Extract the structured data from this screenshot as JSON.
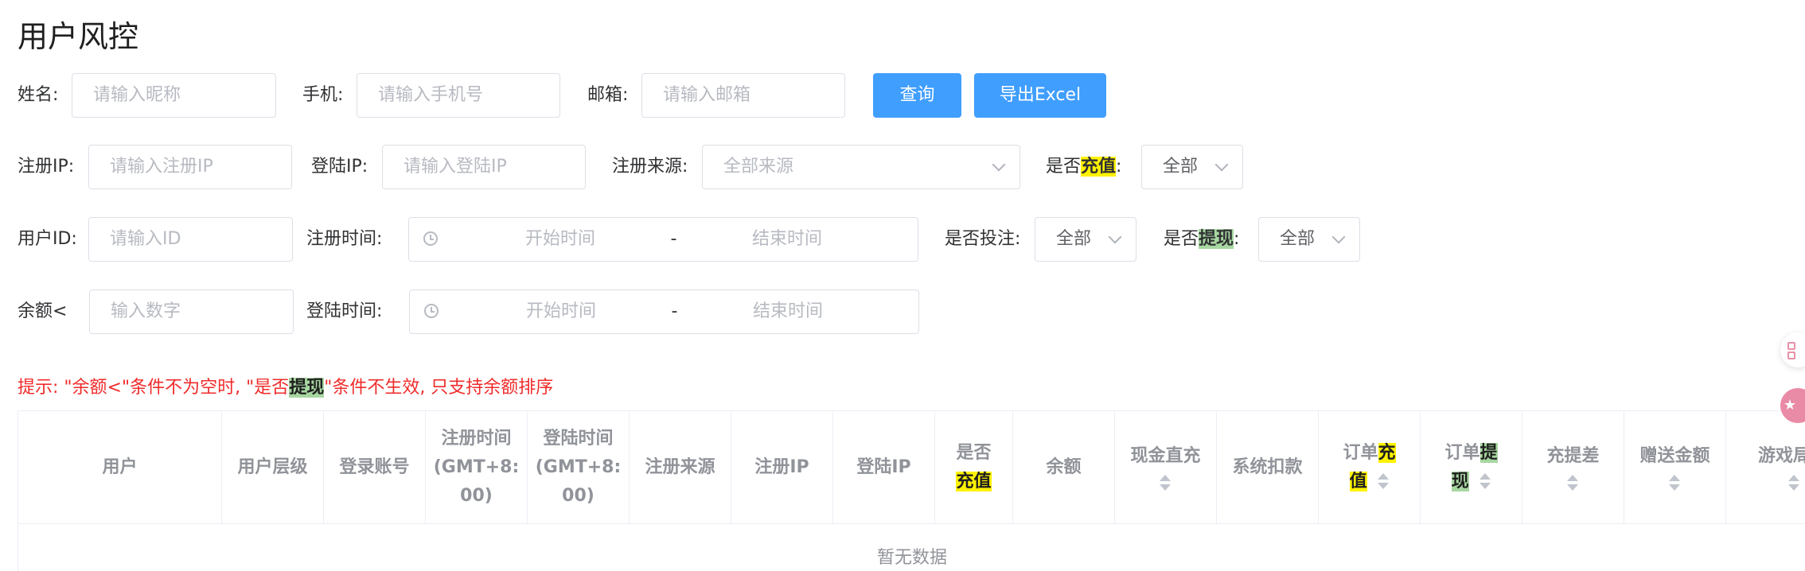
{
  "page_title": "用户风控",
  "filters": {
    "name": {
      "label": "姓名:",
      "placeholder": "请输入昵称"
    },
    "phone": {
      "label": "手机:",
      "placeholder": "请输入手机号"
    },
    "email": {
      "label": "邮箱:",
      "placeholder": "请输入邮箱"
    },
    "register_ip": {
      "label": "注册IP:",
      "placeholder": "请输入注册IP"
    },
    "login_ip": {
      "label": "登陆IP:",
      "placeholder": "请输入登陆IP"
    },
    "register_source": {
      "label": "注册来源:",
      "placeholder": "全部来源"
    },
    "recharge": {
      "label_prefix": "是否",
      "label_highlight": "充值",
      "label_suffix": ":",
      "value": "全部"
    },
    "user_id": {
      "label": "用户ID:",
      "placeholder": "请输入ID"
    },
    "register_time": {
      "label": "注册时间:",
      "start_placeholder": "开始时间",
      "separator": "-",
      "end_placeholder": "结束时间"
    },
    "bet": {
      "label": "是否投注:",
      "value": "全部"
    },
    "withdraw": {
      "label_prefix": "是否",
      "label_highlight": "提现",
      "label_suffix": ":",
      "value": "全部"
    },
    "balance": {
      "label": "余额<",
      "placeholder": "输入数字"
    },
    "login_time": {
      "label": "登陆时间:",
      "start_placeholder": "开始时间",
      "separator": "-",
      "end_placeholder": "结束时间"
    }
  },
  "buttons": {
    "query": "查询",
    "export": "导出Excel"
  },
  "hint": {
    "part1": "提示: \"余额<\"条件不为空时, \"是否",
    "highlight": "提现",
    "part2": "\"条件不生效, 只支持余额排序"
  },
  "table": {
    "columns": [
      {
        "label": "用户"
      },
      {
        "label": "用户层级"
      },
      {
        "label": "登录账号"
      },
      {
        "line1": "注册时间",
        "line2": "(GMT+8:",
        "line3": "00)"
      },
      {
        "line1": "登陆时间",
        "line2": "(GMT+8:",
        "line3": "00)"
      },
      {
        "label": "注册来源"
      },
      {
        "label": "注册IP"
      },
      {
        "label": "登陆IP"
      },
      {
        "line1": "是否",
        "highlight": "充值"
      },
      {
        "label": "余额"
      },
      {
        "label": "现金直充",
        "sortable": true
      },
      {
        "label": "系统扣款"
      },
      {
        "prefix": "订单",
        "highlight_a": "充",
        "highlight_b": "值",
        "sortable": true
      },
      {
        "prefix": "订单",
        "highlight_a": "提",
        "highlight_b": "现",
        "sortable": true
      },
      {
        "label": "充提差",
        "sortable": true
      },
      {
        "label": "赠送金额",
        "sortable": true
      },
      {
        "label": "游戏局数",
        "sortable": true
      }
    ],
    "empty_text": "暂无数据"
  },
  "colors": {
    "primary": "#409eff",
    "hint_red": "#f02b2b",
    "highlight_yellow": "#fff200",
    "highlight_green": "#a7d7a1"
  },
  "icons": [
    "clock-icon",
    "chevron-down-icon",
    "sort-icon",
    "apps-icon",
    "star-icon"
  ]
}
